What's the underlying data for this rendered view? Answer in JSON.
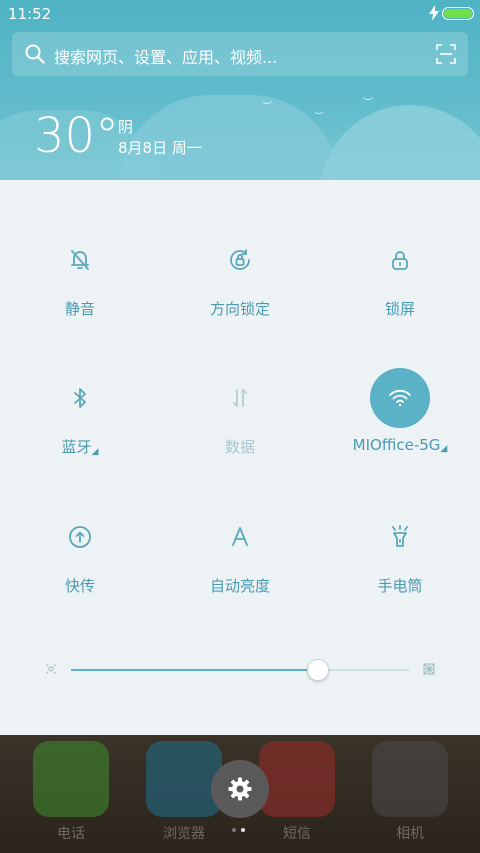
{
  "status_bar": {
    "time": "11:52",
    "battery_level": 1.0
  },
  "search": {
    "placeholder": "搜索网页、设置、应用、视频..."
  },
  "weather": {
    "temperature": "30°",
    "condition": "阴",
    "date": "8月8日 周一"
  },
  "tiles": [
    {
      "label": "静音",
      "icon": "mute-bell-icon",
      "enabled": true,
      "active": false
    },
    {
      "label": "方向锁定",
      "icon": "rotation-lock-icon",
      "enabled": true,
      "active": false
    },
    {
      "label": "锁屏",
      "icon": "lock-icon",
      "enabled": true,
      "active": false
    },
    {
      "label": "蓝牙",
      "icon": "bluetooth-icon",
      "enabled": true,
      "active": false,
      "expand": "◢"
    },
    {
      "label": "数据",
      "icon": "mobile-data-icon",
      "enabled": false,
      "active": false
    },
    {
      "label": "MIOffice-5G",
      "icon": "wifi-icon",
      "enabled": true,
      "active": true,
      "expand": "◢"
    },
    {
      "label": "快传",
      "icon": "quick-transfer-icon",
      "enabled": true,
      "active": false
    },
    {
      "label": "自动亮度",
      "icon": "auto-brightness-icon",
      "enabled": true,
      "active": false
    },
    {
      "label": "手电筒",
      "icon": "flashlight-icon",
      "enabled": true,
      "active": false
    }
  ],
  "brightness": {
    "level": 0.73
  },
  "dock": {
    "apps": [
      {
        "label": "电话",
        "icon": "phone-icon",
        "color": "#3f8f2f"
      },
      {
        "label": "浏览器",
        "icon": "browser-icon",
        "color": "#1f6f8f"
      },
      {
        "label": "短信",
        "icon": "messages-icon",
        "color": "#9e2b2b"
      },
      {
        "label": "相机",
        "icon": "camera-icon",
        "color": "#4a4a4a"
      }
    ],
    "page_count": 2,
    "current_page": 2
  },
  "colors": {
    "accent": "#5bb1c6",
    "label": "#4a9ab0",
    "panel_bg": "#edf2f4",
    "header_bg": "#5fbac9"
  }
}
